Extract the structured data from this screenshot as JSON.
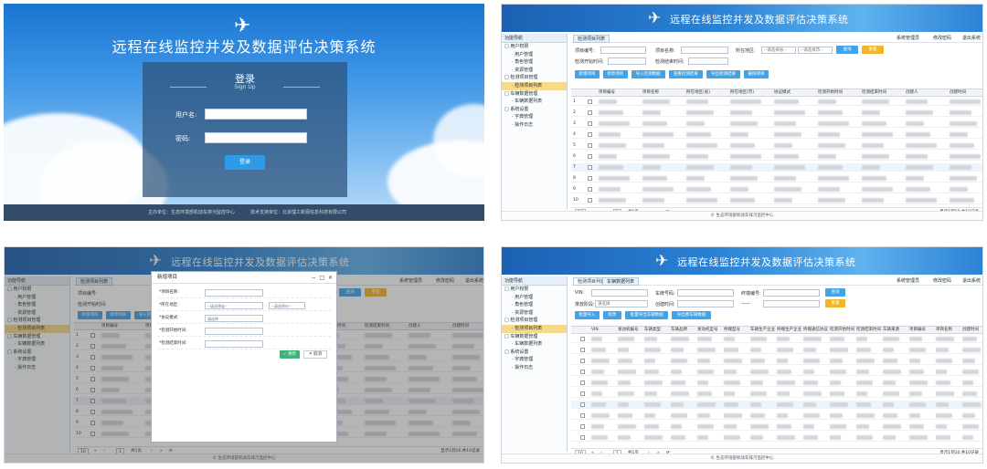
{
  "login": {
    "title": "远程在线监控并发及数据评估决策系统",
    "box_title": "登录",
    "box_subtitle": "Sign Up",
    "username_label": "用户名:",
    "password_label": "密码:",
    "submit_label": "登录",
    "footer_left": "主办单位：生态环境部机动车排污监控中心",
    "footer_right": "技术支持单位：北京理工新源信息科技有限公司"
  },
  "app": {
    "title": "远程在线监控并发及数据评估决策系统",
    "nav_header": "功能导航",
    "nav_items": [
      {
        "label": "□ 用户权限",
        "indent": 0,
        "selected": false
      },
      {
        "label": "· 用户管理",
        "indent": 1,
        "selected": false
      },
      {
        "label": "· 角色管理",
        "indent": 1,
        "selected": false
      },
      {
        "label": "· 资源管理",
        "indent": 1,
        "selected": false
      },
      {
        "label": "□ 检测项目管理",
        "indent": 0,
        "selected": false
      },
      {
        "label": "· 检测项目列表",
        "indent": 1,
        "selected": true
      },
      {
        "label": "□ 车辆数据管理",
        "indent": 0,
        "selected": false
      },
      {
        "label": "· 车辆数据列表",
        "indent": 1,
        "selected": false
      },
      {
        "label": "□ 系统设置",
        "indent": 0,
        "selected": false
      },
      {
        "label": "· 字典管理",
        "indent": 1,
        "selected": false
      },
      {
        "label": "· 操作日志",
        "indent": 1,
        "selected": false
      }
    ],
    "top_links": [
      "系统管理员",
      "修改密码",
      "退出系统"
    ],
    "footer": "© 生态环境部机动车排污监控中心"
  },
  "projects": {
    "tab": "检测项目列表",
    "filters": [
      {
        "label": "项目编号:",
        "value": ""
      },
      {
        "label": "项目名称:",
        "value": ""
      },
      {
        "label": "所在地区:",
        "value": "--请选择省--"
      },
      {
        "label": "",
        "value": "--请选择市--"
      },
      {
        "label": "检测开始时间:",
        "value": ""
      },
      {
        "label": "检测结束时间:",
        "value": ""
      }
    ],
    "search_label": "查询",
    "reset_label": "重置",
    "actions": [
      "新增项目",
      "修改项目",
      "导入检测数据",
      "查看检测结果",
      "导出检测结果",
      "删除项目"
    ],
    "columns": [
      "项目编号",
      "项目名称",
      "所在地区(省)",
      "所在地区(市)",
      "协议模式",
      "检测开始时间",
      "检测结束时间",
      "创建人",
      "创建时间"
    ],
    "row_numbers": [
      "1",
      "2",
      "3",
      "4",
      "5",
      "6",
      "7",
      "8",
      "9",
      "10"
    ],
    "pager": {
      "page_size": "10",
      "page": "1",
      "total_pages": "共1页",
      "summary": "显示1到10,共10记录"
    }
  },
  "modal": {
    "title": "新增项目",
    "fields": [
      {
        "label": "*项目名称:",
        "value": "",
        "extra": ""
      },
      {
        "label": "*所在地区:",
        "value": "--请选择省--",
        "extra": "--请选择市--"
      },
      {
        "label": "*协议模式:",
        "value": "请选择",
        "extra": ""
      },
      {
        "label": "*检测开始时间:",
        "value": "",
        "extra": ""
      },
      {
        "label": "*检测结束时间:",
        "value": "",
        "extra": ""
      }
    ],
    "save_label": "保存",
    "cancel_label": "取消"
  },
  "vehicles": {
    "tabs": [
      "检测项目列表",
      "车辆数据列表"
    ],
    "filters": [
      {
        "label": "VIN:",
        "value": ""
      },
      {
        "label": "车牌号码:",
        "value": ""
      },
      {
        "label": "终端编号:",
        "value": ""
      },
      {
        "label": "排放阶段:",
        "value": "请选择"
      },
      {
        "label": "创建时间:",
        "value": ""
      },
      {
        "label": "——",
        "value": ""
      }
    ],
    "search_label": "查询",
    "reset_label": "重置",
    "actions": [
      "批量导入",
      "修改",
      "批量导出车辆数据",
      "导出原车辆数据"
    ],
    "columns": [
      "VIN",
      "发动机编号",
      "车辆类型",
      "车辆品牌",
      "发动机型号",
      "终端型号",
      "车辆生产企业",
      "终端生产企业",
      "终端通信协议",
      "检测开始时间",
      "检测结束时间",
      "车辆来源",
      "项目编号",
      "项目名称",
      "创建时间"
    ],
    "pager": {
      "page_size": "10",
      "page": "1",
      "total_pages": "共1页",
      "summary": "显示1到10,共10记录"
    }
  }
}
